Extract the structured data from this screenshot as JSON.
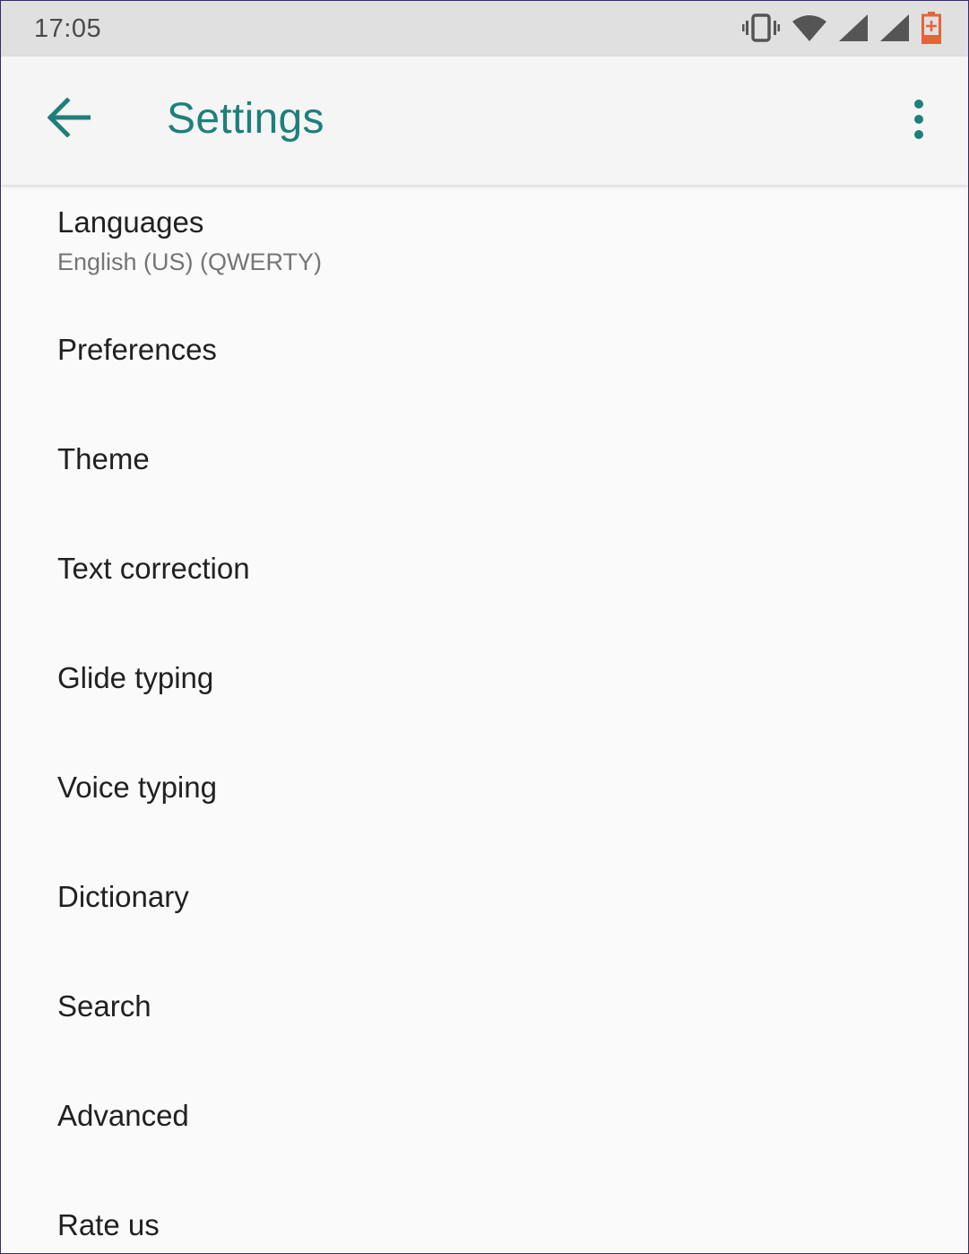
{
  "status_bar": {
    "time": "17:05",
    "icons": [
      "vibrate-icon",
      "wifi-icon",
      "signal-icon",
      "signal-icon",
      "battery-charging-icon"
    ],
    "battery_color": "#e8623a"
  },
  "app_bar": {
    "title": "Settings",
    "accent_color": "#1e7f7b",
    "back_icon": "arrow-back-icon",
    "menu_icon": "more-vert-icon"
  },
  "settings": {
    "items": [
      {
        "id": "languages",
        "title": "Languages",
        "summary": "English (US) (QWERTY)"
      },
      {
        "id": "preferences",
        "title": "Preferences"
      },
      {
        "id": "theme",
        "title": "Theme"
      },
      {
        "id": "text-correction",
        "title": "Text correction"
      },
      {
        "id": "glide-typing",
        "title": "Glide typing"
      },
      {
        "id": "voice-typing",
        "title": "Voice typing"
      },
      {
        "id": "dictionary",
        "title": "Dictionary"
      },
      {
        "id": "search",
        "title": "Search"
      },
      {
        "id": "advanced",
        "title": "Advanced"
      },
      {
        "id": "rate-us",
        "title": "Rate us"
      }
    ]
  }
}
